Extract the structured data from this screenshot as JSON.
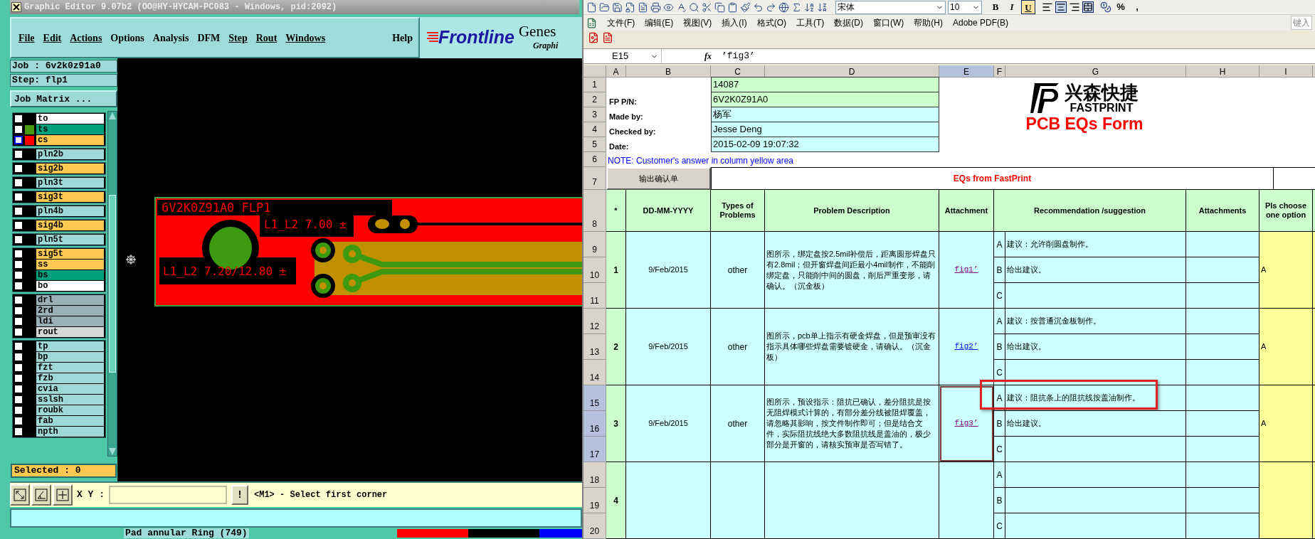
{
  "genesis": {
    "title": "Graphic Editor 9.07b2 (OO@HY-HYCAM-PC083 - Windows, pid:2092)",
    "menu": [
      {
        "label": "File",
        "underlined": true
      },
      {
        "label": "Edit",
        "underlined": true
      },
      {
        "label": "Actions",
        "underlined": true
      },
      {
        "label": "Options",
        "underlined": false
      },
      {
        "label": "Analysis",
        "underlined": false
      },
      {
        "label": "DFM",
        "underlined": false
      },
      {
        "label": "Step",
        "underlined": true
      },
      {
        "label": "Rout",
        "underlined": true
      },
      {
        "label": "Windows",
        "underlined": true
      },
      {
        "label": "Help",
        "underlined": false
      }
    ],
    "logo": {
      "brand": "Frontline",
      "product": "Genes",
      "subtitle": "Graphi"
    },
    "job": "Job : 6v2k0z91a0",
    "step": "Step: flp1",
    "job_matrix_button": "Job Matrix ...",
    "layer_groups": [
      [
        {
          "name": "to",
          "color": "#ffffff",
          "selected": false
        },
        {
          "name": "ts",
          "color": "#00a07c",
          "swatch": {
            "color": "#4a9a10"
          },
          "selected": false
        },
        {
          "name": "cs",
          "color": "#ffc850",
          "swatch": {
            "color": "#ff0000"
          },
          "selected": true
        }
      ],
      [
        {
          "name": "pln2b",
          "color": "#9ed8d8",
          "selected": false
        }
      ],
      [
        {
          "name": "sig2b",
          "color": "#ffc850",
          "selected": false
        }
      ],
      [
        {
          "name": "pln3t",
          "color": "#9ed8d8",
          "selected": false
        }
      ],
      [
        {
          "name": "sig3t",
          "color": "#ffc850",
          "selected": false
        }
      ],
      [
        {
          "name": "pln4b",
          "color": "#9ed8d8",
          "selected": false
        }
      ],
      [
        {
          "name": "sig4b",
          "color": "#ffc850",
          "selected": false
        }
      ],
      [
        {
          "name": "pln5t",
          "color": "#9ed8d8",
          "selected": false
        }
      ],
      [
        {
          "name": "sig5t",
          "color": "#ffc850",
          "selected": false
        },
        {
          "name": "ss",
          "color": "#ffc850",
          "selected": false
        },
        {
          "name": "bs",
          "color": "#00a07c",
          "selected": false
        },
        {
          "name": "bo",
          "color": "#ffffff",
          "selected": false
        }
      ],
      [
        {
          "name": "drl",
          "color": "#9ab0b8",
          "selected": false
        },
        {
          "name": "2rd",
          "color": "#9ab0b8",
          "selected": false
        },
        {
          "name": "ldi",
          "color": "#9ab0b8",
          "selected": false
        },
        {
          "name": "rout",
          "color": "#d8d8d8",
          "selected": false
        }
      ],
      [
        {
          "name": "tp",
          "color": "#9ed8d8",
          "selected": false
        },
        {
          "name": "bp",
          "color": "#9ed8d8",
          "selected": false
        },
        {
          "name": "fzt",
          "color": "#9ed8d8",
          "selected": false
        },
        {
          "name": "fzb",
          "color": "#9ed8d8",
          "selected": false
        },
        {
          "name": "cvia",
          "color": "#9ed8d8",
          "selected": false
        },
        {
          "name": "sslsh",
          "color": "#9ed8d8",
          "selected": false
        },
        {
          "name": "roubk",
          "color": "#9ed8d8",
          "selected": false
        },
        {
          "name": "fab",
          "color": "#9ed8d8",
          "selected": false
        },
        {
          "name": "npth",
          "color": "#9ed8d8",
          "selected": false
        }
      ]
    ],
    "selected_count": "Selected : 0",
    "canvas": {
      "board_label": "6V2K0Z91A0 FLP1",
      "annotations": [
        "L1_L2 7.00 ±",
        "L1_L2 7.20/12.80 ±"
      ]
    },
    "coordinate_label": "X Y :",
    "alert_button": "!",
    "message": "<M1> - Select first corner",
    "bottom_text": "Pad annular Ring (749)"
  },
  "excel": {
    "toolbar": {
      "font": "宋体",
      "size": "10",
      "bold": "B",
      "italic": "I",
      "underline": "U",
      "underline_on": true,
      "percent": "%",
      "comma": ","
    },
    "menu": [
      "文件(F)",
      "编辑(E)",
      "视图(V)",
      "插入(I)",
      "格式(O)",
      "工具(T)",
      "数据(D)",
      "窗口(W)",
      "帮助(H)",
      "Adobe PDF(B)"
    ],
    "help_box": "键入",
    "name_box": "E15",
    "function_label": "fx",
    "formula": "’fig3’",
    "columns": [
      {
        "label": "A",
        "selected": false
      },
      {
        "label": "B",
        "selected": false
      },
      {
        "label": "C",
        "selected": false
      },
      {
        "label": "D",
        "selected": false
      },
      {
        "label": "E",
        "selected": true
      },
      {
        "label": "F",
        "selected": false
      },
      {
        "label": "G",
        "selected": false
      },
      {
        "label": "H",
        "selected": false
      },
      {
        "label": "I",
        "selected": false
      }
    ],
    "info": [
      {
        "row": "1",
        "value": "14087",
        "color": "#ccffcc"
      },
      {
        "row": "2",
        "label": "FP P/N:",
        "value": "6V2K0Z91A0",
        "color": "#ccffcc"
      },
      {
        "row": "3",
        "label": "Made by:",
        "value": "杨军",
        "color": "#ccffff"
      },
      {
        "row": "4",
        "label": "Checked by:",
        "value": "Jesse Deng",
        "color": "#ccffff"
      },
      {
        "row": "5",
        "label": "Date:",
        "value": "2015-02-09 19:07:32",
        "color": "#ccffff"
      }
    ],
    "logo": {
      "chinese": "兴森快捷",
      "english": "FASTPRINT",
      "form_title": "PCB EQs Form"
    },
    "note": {
      "row": "6",
      "text": "NOTE: Customer's  answer in column yellow area"
    },
    "title_row": {
      "row": "7",
      "button": "输出确认单",
      "title": "EQs from FastPrint"
    },
    "header": {
      "row": "8",
      "cells": [
        "*",
        "DD-MM-YYYY",
        "Types of Problems",
        "Problem Description",
        "Attachment",
        "Recommendation /suggestion",
        "Attachments",
        "Pls choose one option"
      ]
    },
    "problems": [
      {
        "rows": [
          {
            "label": "9",
            "selected": false
          },
          {
            "label": "10",
            "selected": false
          },
          {
            "label": "11",
            "selected": false
          }
        ],
        "number": "1",
        "date": "9/Feb/2015",
        "type": "other",
        "description": "图所示，绑定盘按2.5mil补偿后，距离圆形焊盘只有2.8mil；但开窗焊盘间距最小4mil制作，不能削绑定盘，只能削中间的圆盘，削后严重变形，请确认。（沉金板）",
        "attachment": "fig1’",
        "visited": true,
        "selected": false,
        "options": [
          {
            "letter": "A",
            "text": "建议：允许削圆盘制作。",
            "highlighted": false
          },
          {
            "letter": "B",
            "text": "给出建议。",
            "highlighted": false
          },
          {
            "letter": "C",
            "highlighted": false
          }
        ],
        "choice": "A"
      },
      {
        "rows": [
          {
            "label": "12",
            "selected": false
          },
          {
            "label": "13",
            "selected": false
          },
          {
            "label": "14",
            "selected": false
          }
        ],
        "number": "2",
        "date": "9/Feb/2015",
        "type": "other",
        "description": "图所示，pcb单上指示有硬金焊盘，但是预审没有指示具体哪些焊盘需要镀硬金，请确认。（沉金板）",
        "attachment": "fig2’",
        "visited": false,
        "selected": false,
        "options": [
          {
            "letter": "A",
            "text": "建议：按普通沉金板制作。",
            "highlighted": false
          },
          {
            "letter": "B",
            "text": "给出建议。",
            "highlighted": false
          },
          {
            "letter": "C",
            "highlighted": false
          }
        ],
        "choice": "A"
      },
      {
        "rows": [
          {
            "label": "15",
            "selected": true
          },
          {
            "label": "16",
            "selected": true
          },
          {
            "label": "17",
            "selected": true
          }
        ],
        "number": "3",
        "date": "9/Feb/2015",
        "type": "other",
        "description": "图所示，预设指示：阻抗已确认，差分阻抗是按无阻焊模式计算的，有部分差分线被阻焊覆盖，请忽略其影响，按文件制作即可；但是结合文件，实际阻抗线绝大多数阻抗线是盖油的，极少部分是开窗的，请核实预审是否写错了。",
        "attachment": "fig3’",
        "visited": true,
        "selected": true,
        "options": [
          {
            "letter": "A",
            "text": "建议：阻抗条上的阻抗线按盖油制作。",
            "highlighted": true
          },
          {
            "letter": "B",
            "text": "给出建议。",
            "highlighted": false
          },
          {
            "letter": "C",
            "highlighted": false
          }
        ],
        "choice": "A"
      },
      {
        "rows": [
          {
            "label": "18",
            "selected": false
          },
          {
            "label": "19",
            "selected": false
          },
          {
            "label": "20",
            "selected": false
          }
        ],
        "number": "4",
        "selected": false,
        "options": [
          {
            "letter": "A",
            "highlighted": false
          },
          {
            "letter": "B",
            "highlighted": false
          },
          {
            "letter": "C",
            "highlighted": false
          }
        ]
      }
    ]
  }
}
